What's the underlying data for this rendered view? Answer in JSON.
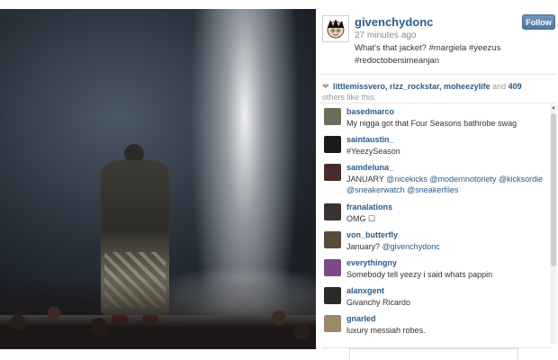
{
  "post": {
    "username": "givenchydonc",
    "timestamp": "27 minutes ago",
    "caption": "What's that jacket? #margiela #yeezus #redoctobersimeanjan",
    "follow_label": "Follow",
    "avatar_icon": "astro-boy-avatar-icon"
  },
  "likes": {
    "heart_icon": "heart-icon",
    "names": "littlemissvero, rizz_rockstar, moheezylife",
    "and": " and ",
    "count": "409",
    "suffix": "others like this."
  },
  "comments": [
    {
      "user": "basedmarco",
      "text": "My nigga got that Four Seasons bathrobe swag",
      "avatar_color": "#6b6f5a"
    },
    {
      "user": "saintaustin_",
      "text": "#YeezySeason",
      "avatar_color": "#1a1a1a"
    },
    {
      "user": "samdeluna_",
      "text_prefix": "JANUARY ",
      "text_links": "@nicekicks @modernnotoriety @kicksordie @sneakerwatch @sneakerfiles",
      "avatar_color": "#4a2b2b"
    },
    {
      "user": "franalations",
      "text": "OMG ☐",
      "avatar_color": "#3a3130"
    },
    {
      "user": "von_butterfly",
      "text_prefix": "January? ",
      "text_links": "@givenchydonc",
      "avatar_color": "#5a4a3a"
    },
    {
      "user": "everythingny",
      "text": "Somebody tell yeezy i said whats pappin",
      "avatar_color": "#7a4a8a"
    },
    {
      "user": "alanxgent",
      "text": "Givanchy Ricardo",
      "avatar_color": "#2a2a2a"
    },
    {
      "user": "gnarled",
      "text": "luxury messiah robes.",
      "avatar_color": "#9a8a6a"
    }
  ],
  "colors": {
    "link": "#2a5c8a",
    "follow_bg": "#5a84ab"
  }
}
